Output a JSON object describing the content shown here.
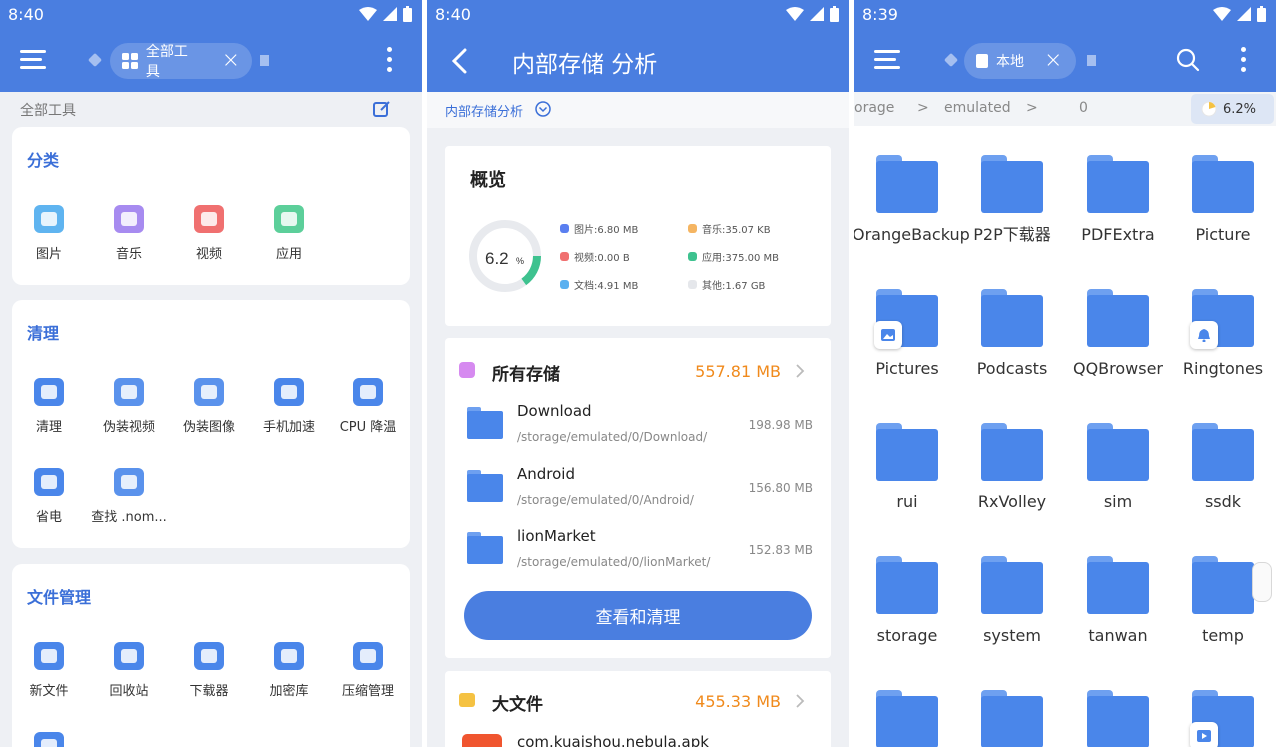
{
  "panel1": {
    "status": {
      "time": "8:40"
    },
    "chip_label": "全部工具",
    "subheader": "全部工具",
    "sections": [
      {
        "title": "分类",
        "items": [
          "图片",
          "音乐",
          "视频",
          "应用"
        ]
      },
      {
        "title": "清理",
        "items": [
          "清理",
          "伪装视频",
          "伪装图像",
          "手机加速",
          "CPU 降温",
          "省电",
          "查找 .nom..."
        ]
      },
      {
        "title": "文件管理",
        "items": [
          "新文件",
          "回收站",
          "下载器",
          "加密库",
          "压缩管理"
        ]
      }
    ]
  },
  "panel2": {
    "status": {
      "time": "8:40"
    },
    "title": "内部存储 分析",
    "filter_label": "内部存储分析",
    "overview_title": "概览",
    "donut_percent": "6.2",
    "donut_unit": "%",
    "legend": [
      "图片:6.80 MB",
      "音乐:35.07 KB",
      "视频:0.00 B",
      "应用:375.00 MB",
      "文档:4.91 MB",
      "其他:1.67 GB"
    ],
    "all_storage_title": "所有存储",
    "all_storage_size": "557.81 MB",
    "storage_rows": [
      {
        "name": "Download",
        "path": "/storage/emulated/0/Download/",
        "size": "198.98 MB"
      },
      {
        "name": "Android",
        "path": "/storage/emulated/0/Android/",
        "size": "156.80 MB"
      },
      {
        "name": "lionMarket",
        "path": "/storage/emulated/0/lionMarket/",
        "size": "152.83 MB"
      }
    ],
    "clean_button": "查看和清理",
    "big_files_title": "大文件",
    "big_files_size": "455.33 MB",
    "big_file_first": "com.kuaishou.nebula.apk"
  },
  "panel3": {
    "status": {
      "time": "8:39"
    },
    "chip_label": "本地",
    "breadcrumb": [
      "orage",
      ">",
      "emulated",
      ">",
      "0"
    ],
    "usage": "6.2%",
    "folders": [
      "OrangeBackup",
      "P2P下载器",
      "PDFExtra",
      "Picture",
      "Pictures",
      "Podcasts",
      "QQBrowser",
      "Ringtones",
      "rui",
      "RxVolley",
      "sim",
      "ssdk",
      "storage",
      "system",
      "tanwan",
      "temp"
    ]
  },
  "colors": {
    "accent": "#4a7ee0",
    "orange": "#f08a1c",
    "donut_green": "#3ec28f"
  }
}
